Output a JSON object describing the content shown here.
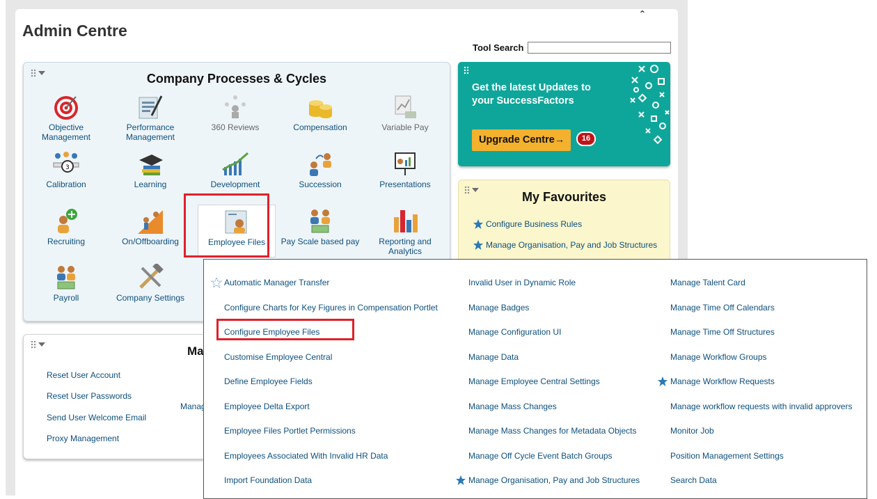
{
  "header": {
    "title": "Admin Centre",
    "tool_search_label": "Tool Search",
    "tool_search_value": ""
  },
  "processes": {
    "title": "Company Processes & Cycles",
    "tiles": [
      {
        "label": "Objective Management",
        "icon": "target-icon"
      },
      {
        "label": "Performance Management",
        "icon": "performance-icon"
      },
      {
        "label": "360 Reviews",
        "icon": "360-reviews-icon"
      },
      {
        "label": "Compensation",
        "icon": "coins-icon"
      },
      {
        "label": "Variable Pay",
        "icon": "variable-pay-icon"
      },
      {
        "label": "Calibration",
        "icon": "calibration-icon"
      },
      {
        "label": "Learning",
        "icon": "graduation-cap-icon"
      },
      {
        "label": "Development",
        "icon": "development-chart-icon"
      },
      {
        "label": "Succession",
        "icon": "succession-icon"
      },
      {
        "label": "Presentations",
        "icon": "presentation-icon"
      },
      {
        "label": "Recruiting",
        "icon": "recruiting-icon"
      },
      {
        "label": "On/Offboarding",
        "icon": "onboarding-icon"
      },
      {
        "label": "Employee Files",
        "icon": "employee-files-icon"
      },
      {
        "label": "Pay Scale based pay",
        "icon": "pay-scale-icon"
      },
      {
        "label": "Reporting and Analytics",
        "icon": "analytics-icon"
      },
      {
        "label": "Payroll",
        "icon": "payroll-icon"
      },
      {
        "label": "Company Settings",
        "icon": "tools-icon"
      }
    ]
  },
  "updates": {
    "text": "Get the latest Updates to your SuccessFactors",
    "button_label": "Upgrade Centre",
    "badge_count": "16",
    "color": "#0ea69a"
  },
  "favourites": {
    "title": "My Favourites",
    "items": [
      "Configure Business Rules",
      "Manage Organisation, Pay and Job Structures"
    ]
  },
  "manage": {
    "title_partial": "Ma",
    "links": [
      "Reset User Account",
      "Reset User Passwords",
      "Send User Welcome Email",
      "Proxy Management"
    ],
    "middle_partial": "Manag"
  },
  "results": {
    "col1": [
      "Automatic Manager Transfer",
      "Configure Charts for Key Figures in Compensation Portlet",
      "Configure Employee Files",
      "Customise Employee Central",
      "Define Employee Fields",
      "Employee Delta Export",
      "Employee Files Portlet Permissions",
      "Employees Associated With Invalid HR Data",
      "Import Foundation Data"
    ],
    "col2": [
      "Invalid User in Dynamic Role",
      "Manage Badges",
      "Manage Configuration UI",
      "Manage Data",
      "Manage Employee Central Settings",
      "Manage Mass Changes",
      "Manage Mass Changes for Metadata Objects",
      "Manage Off Cycle Event Batch Groups",
      "Manage Organisation, Pay and Job Structures"
    ],
    "col3": [
      "Manage Talent Card",
      "Manage Time Off Calendars",
      "Manage Time Off Structures",
      "Manage Workflow Groups",
      "Manage Workflow Requests",
      "Manage workflow requests with invalid approvers",
      "Monitor Job",
      "Position Management Settings",
      "Search Data"
    ]
  },
  "colors": {
    "link": "#0d4f7e",
    "highlight": "#e0202a",
    "star": "#2a7ab8"
  }
}
